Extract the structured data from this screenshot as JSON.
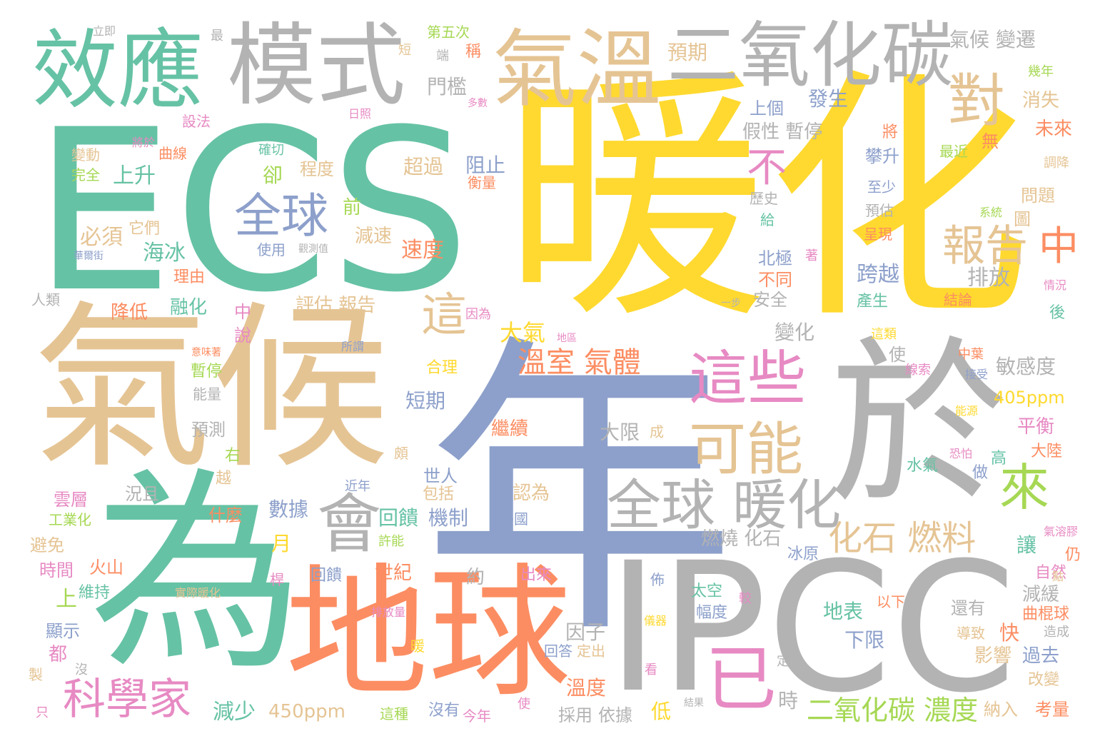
{
  "colors": {
    "green": "#66c2a5",
    "orange": "#fc8d62",
    "blue": "#8da0cb",
    "pink": "#e78ac3",
    "lime": "#a6d854",
    "yellow": "#ffd92f",
    "tan": "#e5c494",
    "gray": "#b3b3b3",
    "background": "#ffffff"
  },
  "words": [
    {
      "text": "暖化",
      "color": "yellow"
    },
    {
      "text": "ECS",
      "color": "green"
    },
    {
      "text": "年",
      "color": "blue"
    },
    {
      "text": "氣候",
      "color": "tan"
    },
    {
      "text": "IPCC",
      "color": "gray"
    },
    {
      "text": "於",
      "color": "gray"
    },
    {
      "text": "為",
      "color": "green"
    },
    {
      "text": "地球",
      "color": "orange"
    },
    {
      "text": "模式",
      "color": "gray"
    },
    {
      "text": "效應",
      "color": "green"
    },
    {
      "text": "氣溫",
      "color": "tan"
    },
    {
      "text": "二氧化碳",
      "color": "gray"
    },
    {
      "text": "對",
      "color": "tan"
    },
    {
      "text": "這些",
      "color": "pink"
    },
    {
      "text": "可能",
      "color": "tan"
    },
    {
      "text": "全球 暖化",
      "color": "gray"
    },
    {
      "text": "會",
      "color": "gray"
    },
    {
      "text": "全球",
      "color": "blue"
    },
    {
      "text": "不",
      "color": "pink"
    },
    {
      "text": "這",
      "color": "tan"
    },
    {
      "text": "報告",
      "color": "tan"
    },
    {
      "text": "中",
      "color": "orange"
    },
    {
      "text": "來",
      "color": "lime"
    },
    {
      "text": "已",
      "color": "pink"
    },
    {
      "text": "科學家",
      "color": "pink"
    },
    {
      "text": "化石 燃料",
      "color": "tan"
    },
    {
      "text": "溫室 氣體",
      "color": "orange"
    },
    {
      "text": "二氧化碳 濃度",
      "color": "lime"
    },
    {
      "text": "氣候 變遷",
      "color": "gray"
    },
    {
      "text": "預期",
      "color": "tan"
    },
    {
      "text": "門檻",
      "color": "gray"
    },
    {
      "text": "發生",
      "color": "blue"
    },
    {
      "text": "上個",
      "color": "blue"
    },
    {
      "text": "假性 暫停",
      "color": "gray"
    },
    {
      "text": "消失",
      "color": "tan"
    },
    {
      "text": "未來",
      "color": "orange"
    },
    {
      "text": "最近",
      "color": "lime"
    },
    {
      "text": "無",
      "color": "orange"
    },
    {
      "text": "攀升",
      "color": "blue"
    },
    {
      "text": "將",
      "color": "orange"
    },
    {
      "text": "上升",
      "color": "green"
    },
    {
      "text": "必須",
      "color": "tan"
    },
    {
      "text": "海冰",
      "color": "green"
    },
    {
      "text": "理由",
      "color": "orange"
    },
    {
      "text": "降低",
      "color": "orange"
    },
    {
      "text": "融化",
      "color": "green"
    },
    {
      "text": "評估 報告",
      "color": "tan"
    },
    {
      "text": "程度",
      "color": "tan"
    },
    {
      "text": "超過",
      "color": "tan"
    },
    {
      "text": "阻止",
      "color": "blue"
    },
    {
      "text": "衡量",
      "color": "orange"
    },
    {
      "text": "減速",
      "color": "tan"
    },
    {
      "text": "速度",
      "color": "orange"
    },
    {
      "text": "前",
      "color": "lime"
    },
    {
      "text": "卻",
      "color": "lime"
    },
    {
      "text": "大氣",
      "color": "yellow"
    },
    {
      "text": "變化",
      "color": "gray"
    },
    {
      "text": "北極",
      "color": "blue"
    },
    {
      "text": "不同",
      "color": "orange"
    },
    {
      "text": "安全",
      "color": "gray"
    },
    {
      "text": "跨越",
      "color": "blue"
    },
    {
      "text": "排放",
      "color": "gray"
    },
    {
      "text": "至少",
      "color": "blue"
    },
    {
      "text": "預估",
      "color": "gray"
    },
    {
      "text": "呈現",
      "color": "orange"
    },
    {
      "text": "問題",
      "color": "tan"
    },
    {
      "text": "產生",
      "color": "green"
    },
    {
      "text": "結論",
      "color": "orange"
    },
    {
      "text": "後",
      "color": "green"
    },
    {
      "text": "敏感度",
      "color": "gray"
    },
    {
      "text": "405ppm",
      "color": "yellow"
    },
    {
      "text": "短期",
      "color": "blue"
    },
    {
      "text": "合理",
      "color": "yellow"
    },
    {
      "text": "繼續",
      "color": "orange"
    },
    {
      "text": "大限",
      "color": "gray"
    },
    {
      "text": "平衡",
      "color": "pink"
    },
    {
      "text": "大陸",
      "color": "orange"
    },
    {
      "text": "水氣",
      "color": "green"
    },
    {
      "text": "高",
      "color": "green"
    },
    {
      "text": "做",
      "color": "blue"
    },
    {
      "text": "認為",
      "color": "tan"
    },
    {
      "text": "數據",
      "color": "blue"
    },
    {
      "text": "回饋",
      "color": "green"
    },
    {
      "text": "機制",
      "color": "blue"
    },
    {
      "text": "什麼",
      "color": "orange"
    },
    {
      "text": "世人",
      "color": "blue"
    },
    {
      "text": "包括",
      "color": "tan"
    },
    {
      "text": "月",
      "color": "yellow"
    },
    {
      "text": "燃燒 化石",
      "color": "gray"
    },
    {
      "text": "冰原",
      "color": "blue"
    },
    {
      "text": "讓",
      "color": "green"
    },
    {
      "text": "自然",
      "color": "pink"
    },
    {
      "text": "仍",
      "color": "orange"
    },
    {
      "text": "減緩",
      "color": "gray"
    },
    {
      "text": "曲棍球",
      "color": "orange"
    },
    {
      "text": "還有",
      "color": "gray"
    },
    {
      "text": "造成",
      "color": "gray"
    },
    {
      "text": "導致",
      "color": "tan"
    },
    {
      "text": "影響",
      "color": "tan"
    },
    {
      "text": "過去",
      "color": "blue"
    },
    {
      "text": "改變",
      "color": "tan"
    },
    {
      "text": "地表",
      "color": "green"
    },
    {
      "text": "下限",
      "color": "blue"
    },
    {
      "text": "快",
      "color": "orange"
    },
    {
      "text": "因子",
      "color": "gray"
    },
    {
      "text": "太空",
      "color": "green"
    },
    {
      "text": "幅度",
      "color": "blue"
    },
    {
      "text": "以下",
      "color": "orange"
    },
    {
      "text": "溫度",
      "color": "orange"
    },
    {
      "text": "時",
      "color": "gray"
    },
    {
      "text": "低",
      "color": "yellow"
    },
    {
      "text": "採用",
      "color": "gray"
    },
    {
      "text": "依據",
      "color": "gray"
    },
    {
      "text": "納入",
      "color": "tan"
    },
    {
      "text": "考量",
      "color": "orange"
    },
    {
      "text": "450ppm",
      "color": "tan"
    },
    {
      "text": "減少",
      "color": "green"
    },
    {
      "text": "世紀",
      "color": "orange"
    },
    {
      "text": "回饋",
      "color": "blue"
    },
    {
      "text": "約",
      "color": "gray"
    },
    {
      "text": "出來",
      "color": "pink"
    },
    {
      "text": "沒有",
      "color": "blue"
    },
    {
      "text": "這種",
      "color": "lime"
    },
    {
      "text": "今年",
      "color": "pink"
    },
    {
      "text": "維持",
      "color": "green"
    },
    {
      "text": "顯示",
      "color": "blue"
    },
    {
      "text": "都",
      "color": "pink"
    },
    {
      "text": "上",
      "color": "lime"
    },
    {
      "text": "時間",
      "color": "pink"
    },
    {
      "text": "火山",
      "color": "orange"
    },
    {
      "text": "避免",
      "color": "tan"
    },
    {
      "text": "工業化",
      "color": "lime"
    },
    {
      "text": "雲層",
      "color": "pink"
    },
    {
      "text": "況且",
      "color": "gray"
    },
    {
      "text": "越",
      "color": "tan"
    },
    {
      "text": "右",
      "color": "lime"
    },
    {
      "text": "預測",
      "color": "gray"
    },
    {
      "text": "能量",
      "color": "gray"
    },
    {
      "text": "暫停",
      "color": "lime"
    },
    {
      "text": "中",
      "color": "pink"
    },
    {
      "text": "說",
      "color": "pink"
    },
    {
      "text": "人類",
      "color": "gray"
    },
    {
      "text": "使用",
      "color": "blue"
    },
    {
      "text": "它們",
      "color": "tan"
    },
    {
      "text": "變動",
      "color": "tan"
    },
    {
      "text": "完全",
      "color": "lime"
    },
    {
      "text": "曲線",
      "color": "orange"
    },
    {
      "text": "設法",
      "color": "pink"
    },
    {
      "text": "確切",
      "color": "green"
    },
    {
      "text": "第五次",
      "color": "lime"
    },
    {
      "text": "稱",
      "color": "orange"
    },
    {
      "text": "幾年",
      "color": "lime"
    },
    {
      "text": "調降",
      "color": "tan"
    },
    {
      "text": "歷史",
      "color": "gray"
    },
    {
      "text": "給",
      "color": "green"
    },
    {
      "text": "圖",
      "color": "tan"
    },
    {
      "text": "系統",
      "color": "lime"
    },
    {
      "text": "著",
      "color": "pink"
    },
    {
      "text": "情況",
      "color": "pink"
    },
    {
      "text": "中葉",
      "color": "orange"
    },
    {
      "text": "線索",
      "color": "pink"
    },
    {
      "text": "接受",
      "color": "blue"
    },
    {
      "text": "這類",
      "color": "yellow"
    },
    {
      "text": "能源",
      "color": "yellow"
    },
    {
      "text": "恐怕",
      "color": "pink"
    },
    {
      "text": "成",
      "color": "tan"
    },
    {
      "text": "氣溶膠",
      "color": "pink"
    },
    {
      "text": "點",
      "color": "tan"
    },
    {
      "text": "較",
      "color": "pink"
    },
    {
      "text": "佈",
      "color": "blue"
    },
    {
      "text": "儀器",
      "color": "yellow"
    },
    {
      "text": "定",
      "color": "gray"
    },
    {
      "text": "結果",
      "color": "gray"
    },
    {
      "text": "使",
      "color": "pink"
    },
    {
      "text": "看",
      "color": "pink"
    },
    {
      "text": "回答",
      "color": "blue"
    },
    {
      "text": "定出",
      "color": "tan"
    },
    {
      "text": "暖",
      "color": "yellow"
    },
    {
      "text": "排放量",
      "color": "pink"
    },
    {
      "text": "實際暖化",
      "color": "tan"
    },
    {
      "text": "桿",
      "color": "pink"
    },
    {
      "text": "許能",
      "color": "lime"
    },
    {
      "text": "美國",
      "color": "blue"
    },
    {
      "text": "近年",
      "color": "blue"
    },
    {
      "text": "所謂",
      "color": "blue"
    },
    {
      "text": "意味著",
      "color": "orange"
    },
    {
      "text": "地區",
      "color": "pink"
    },
    {
      "text": "因為",
      "color": "pink"
    },
    {
      "text": "一步",
      "color": "gray"
    },
    {
      "text": "觀測值",
      "color": "gray"
    },
    {
      "text": "華爾街",
      "color": "blue"
    },
    {
      "text": "只",
      "color": "pink"
    },
    {
      "text": "製",
      "color": "tan"
    },
    {
      "text": "沒",
      "color": "gray"
    },
    {
      "text": "頗",
      "color": "tan"
    },
    {
      "text": "使",
      "color": "gray"
    },
    {
      "text": "將於",
      "color": "pink"
    },
    {
      "text": "日照",
      "color": "pink"
    },
    {
      "text": "多數",
      "color": "pink"
    },
    {
      "text": "立即",
      "color": "gray"
    },
    {
      "text": "最",
      "color": "gray"
    },
    {
      "text": "短",
      "color": "tan"
    },
    {
      "text": "端",
      "color": "gray"
    }
  ]
}
